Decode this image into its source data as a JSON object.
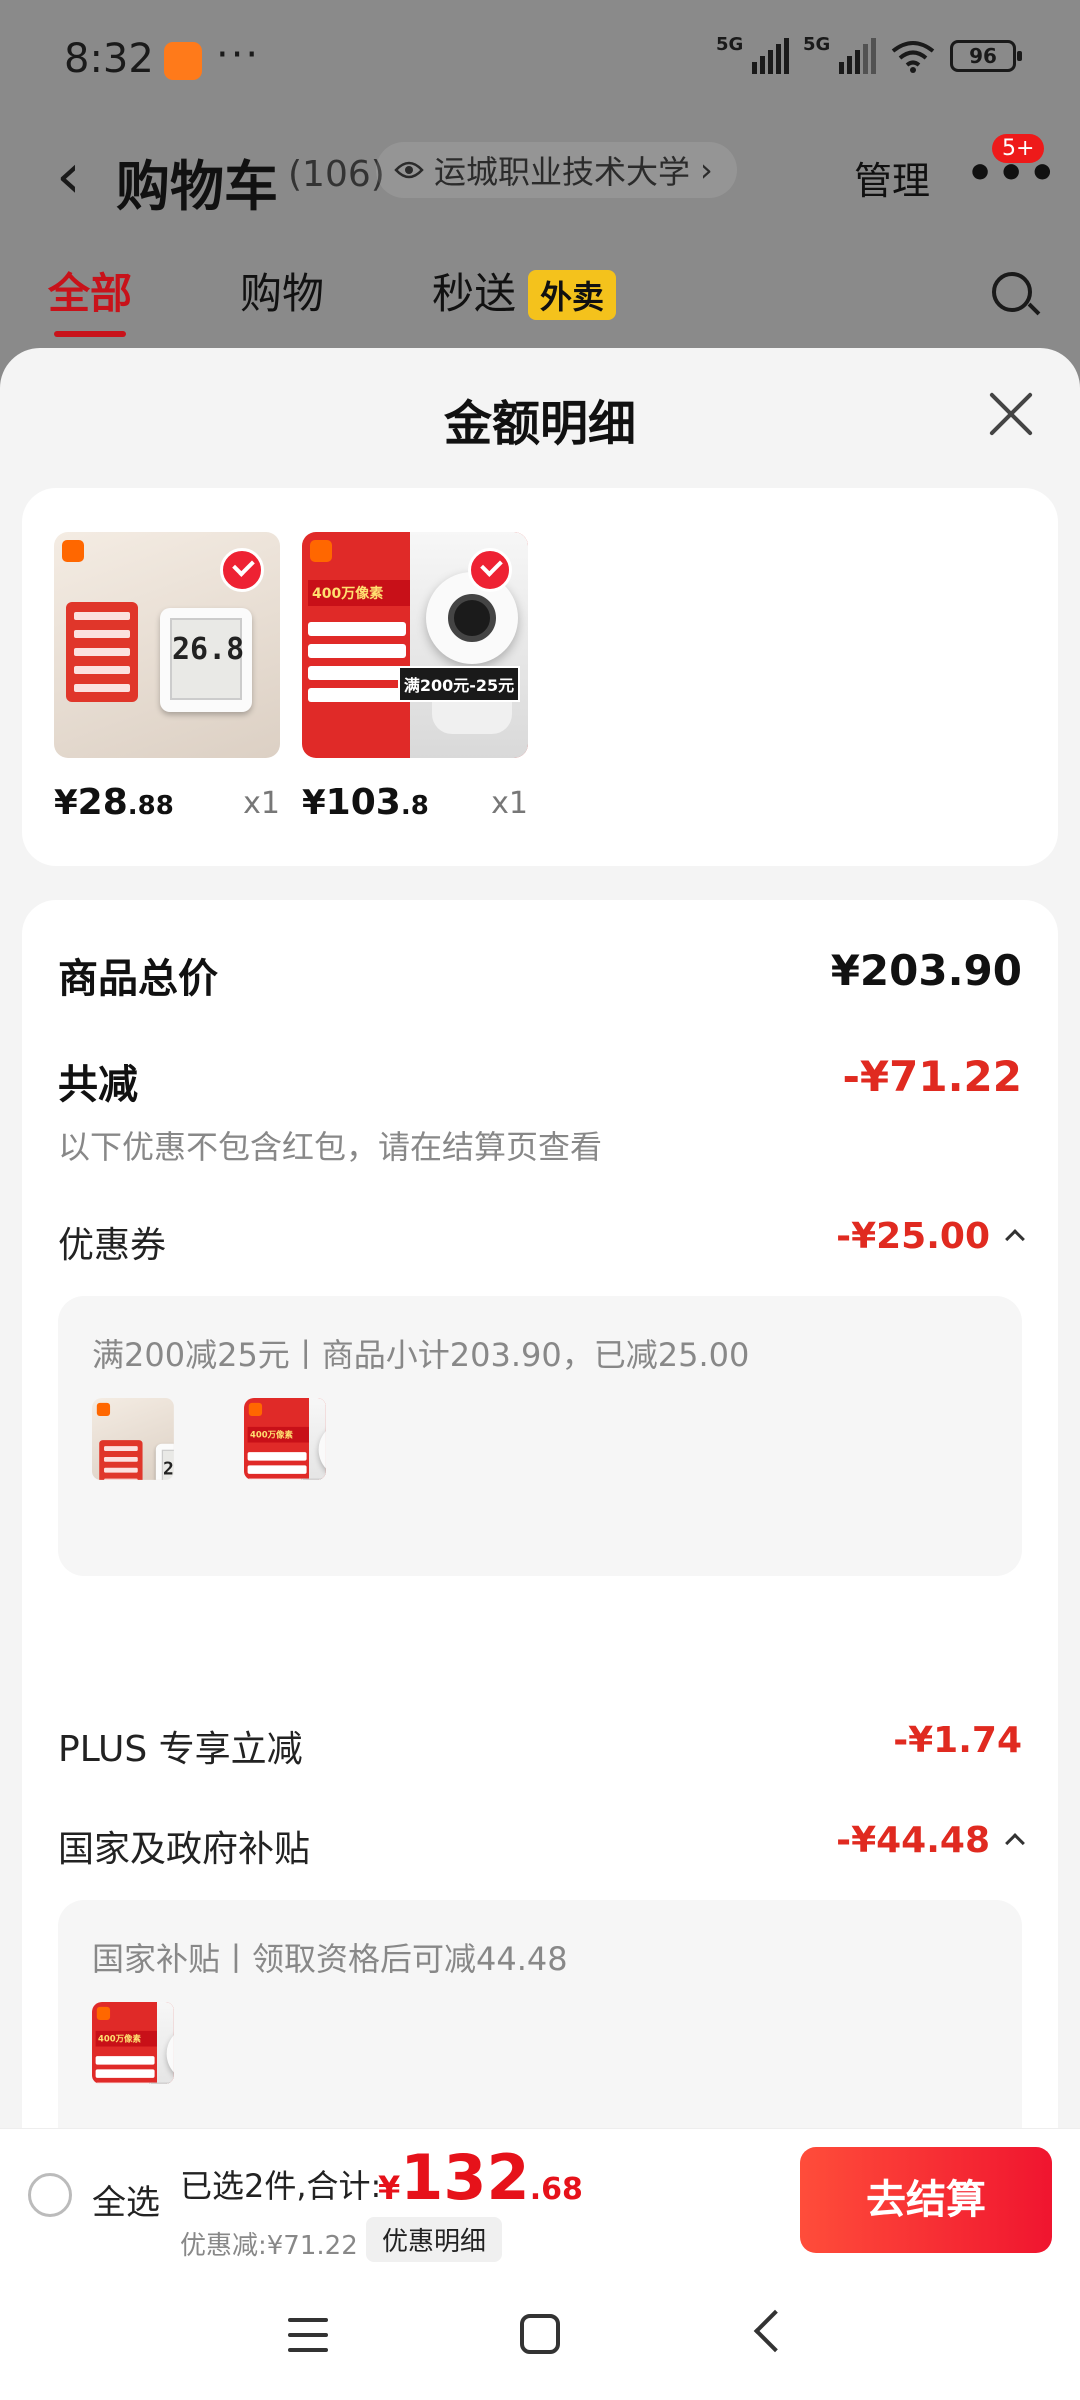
{
  "status_bar": {
    "time": "8:32",
    "more": "···",
    "signal1_label": "5G",
    "signal2_label": "5G",
    "battery": "96"
  },
  "header": {
    "back_icon": "chevron-left-icon",
    "title": "购物车",
    "count": "(106)",
    "location": "运城职业技术大学",
    "location_chevron": "›",
    "manage": "管理",
    "more": "•••",
    "badge": "5+"
  },
  "tabs": [
    {
      "label": "全部"
    },
    {
      "label": "购物"
    },
    {
      "label": "秒送"
    }
  ],
  "tab_badge": "外卖",
  "sheet": {
    "title": "金额明细",
    "products": [
      {
        "price_symbol": "¥",
        "price_int": "28",
        "price_dec": ".88",
        "qty": "x1",
        "display_reading": "26.8"
      },
      {
        "price_symbol": "¥",
        "price_int": "103",
        "price_dec": ".8",
        "qty": "x1",
        "promo_text": "满200元-25元",
        "headline": "400万像素"
      }
    ],
    "total_label": "商品总价",
    "total_value": "¥203.90",
    "reduce_label": "共减",
    "reduce_value": "-¥71.22",
    "reduce_note": "以下优惠不包含红包，请在结算页查看",
    "coupon_label": "优惠券",
    "coupon_value": "-¥25.00",
    "coupon_detail": "满200减25元丨商品小计203.90，已减25.00",
    "plus_label": "PLUS 专享立减",
    "plus_value": "-¥1.74",
    "gov_label": "国家及政府补贴",
    "gov_value": "-¥44.48",
    "gov_detail": "国家补贴丨领取资格后可减44.48"
  },
  "checkout": {
    "select_all": "全选",
    "selected_info": "已选2件,合计:",
    "total_symbol": "¥",
    "total_int": "132",
    "total_dec": ".68",
    "discount_info": "优惠减:¥71.22",
    "detail_button": "优惠明细",
    "pay_button": "去结算"
  },
  "colors": {
    "accent_red": "#e02a20",
    "pay_button": "#f0152f",
    "tab_active": "#c8121a"
  }
}
